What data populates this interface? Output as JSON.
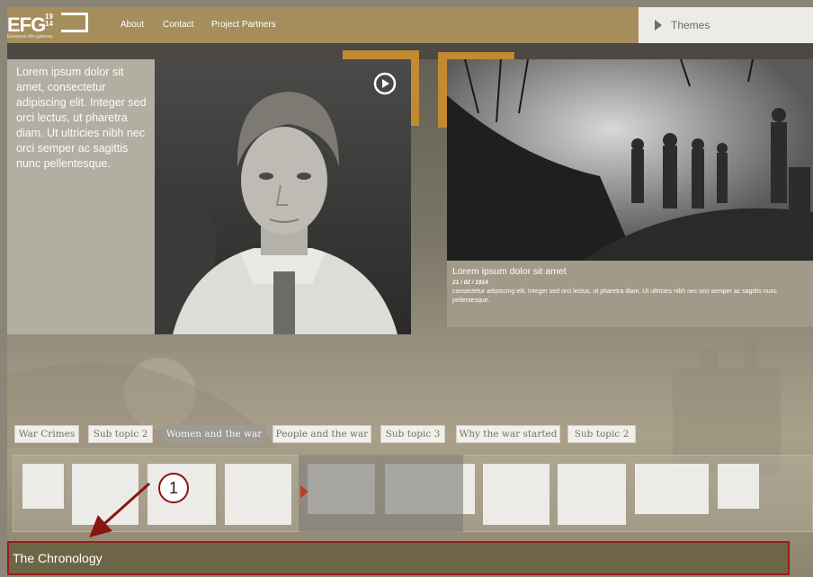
{
  "logo": {
    "text": "EFG",
    "years_top": "19",
    "years_bottom": "14",
    "subtitle": "European film gateway"
  },
  "nav": [
    {
      "label": "About"
    },
    {
      "label": "Contact"
    },
    {
      "label": "Project Partners"
    }
  ],
  "themes": {
    "label": "Themes"
  },
  "intro_text": "Lorem ipsum dolor sit amet, consectetur adipiscing elit. Integer sed orci lectus, ut pharetra diam. Ut ultricies nibh nec orci semper ac sagittis nunc pellentesque.",
  "caption": {
    "title": "Lorem ipsum dolor sit amet",
    "date": "21 / 02 / 1914",
    "body": "consectetur adipiscing elit. Integer sed orci lectus, ut pharetra diam. Ut ultricies nibh nec orci semper ac sagittis nunc pellentesque."
  },
  "topics": [
    {
      "label": "War Crimes",
      "active": false
    },
    {
      "label": "Sub topic 2",
      "active": false
    },
    {
      "label": "Women and the war",
      "active": true
    },
    {
      "label": "People and the war",
      "active": false
    },
    {
      "label": "Sub topic 3",
      "active": false
    },
    {
      "label": "Why the war started",
      "active": false
    },
    {
      "label": "Sub topic 2",
      "active": false
    }
  ],
  "chronology": {
    "label": "The Chronology"
  },
  "callout": {
    "number": "1"
  },
  "colors": {
    "topbar": "#a58e5c",
    "accent_gold": "#c28a33",
    "chronology_bg": "#6e6547",
    "annotation_red": "#9a1d17"
  }
}
